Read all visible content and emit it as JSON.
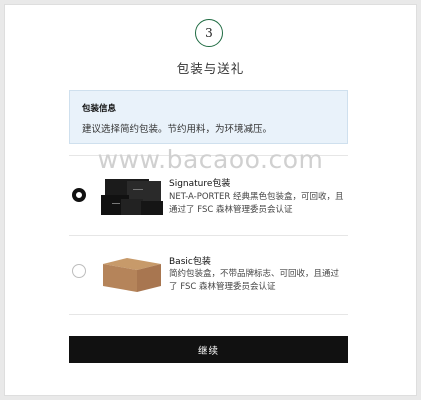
{
  "step": {
    "number": "3",
    "title": "包装与送礼"
  },
  "info": {
    "title": "包装信息",
    "text": "建议选择简约包装。节约用料，为环境减压。"
  },
  "watermark": "www.bacaoo.com",
  "options": [
    {
      "title": "Signature包装",
      "desc": "NET-A-PORTER 经典黑色包装盒，可回收，且通过了 FSC 森林管理委员会认证",
      "selected": true,
      "image": "black-gift-boxes"
    },
    {
      "title": "Basic包装",
      "desc": "简约包装盒，不带品牌标志、可回收，且通过了 FSC 森林管理委员会认证",
      "selected": false,
      "image": "kraft-cardboard-box"
    }
  ],
  "button": {
    "label": "继续"
  },
  "colors": {
    "accent": "#1f6b42",
    "info_bg": "#e9f2fa",
    "button_bg": "#111111"
  }
}
